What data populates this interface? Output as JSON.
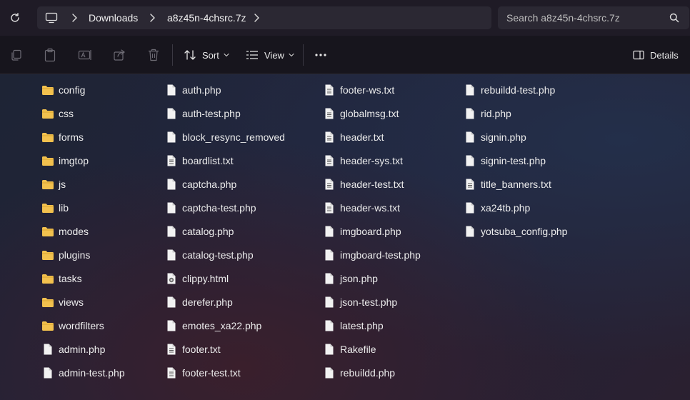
{
  "address_bar": {
    "breadcrumbs": [
      "Downloads",
      "a8z45n-4chsrc.7z"
    ]
  },
  "search": {
    "placeholder": "Search a8z45n-4chsrc.7z"
  },
  "toolbar": {
    "sort_label": "Sort",
    "view_label": "View",
    "details_label": "Details"
  },
  "columns": [
    {
      "items": [
        {
          "name": "config",
          "type": "folder"
        },
        {
          "name": "css",
          "type": "folder"
        },
        {
          "name": "forms",
          "type": "folder"
        },
        {
          "name": "imgtop",
          "type": "folder"
        },
        {
          "name": "js",
          "type": "folder"
        },
        {
          "name": "lib",
          "type": "folder"
        },
        {
          "name": "modes",
          "type": "folder"
        },
        {
          "name": "plugins",
          "type": "folder"
        },
        {
          "name": "tasks",
          "type": "folder"
        },
        {
          "name": "views",
          "type": "folder"
        },
        {
          "name": "wordfilters",
          "type": "folder"
        },
        {
          "name": "admin.php",
          "type": "file"
        },
        {
          "name": "admin-test.php",
          "type": "file"
        }
      ]
    },
    {
      "items": [
        {
          "name": "auth.php",
          "type": "file"
        },
        {
          "name": "auth-test.php",
          "type": "file"
        },
        {
          "name": "block_resync_removed",
          "type": "file"
        },
        {
          "name": "boardlist.txt",
          "type": "text"
        },
        {
          "name": "captcha.php",
          "type": "file"
        },
        {
          "name": "captcha-test.php",
          "type": "file"
        },
        {
          "name": "catalog.php",
          "type": "file"
        },
        {
          "name": "catalog-test.php",
          "type": "file"
        },
        {
          "name": "clippy.html",
          "type": "html"
        },
        {
          "name": "derefer.php",
          "type": "file"
        },
        {
          "name": "emotes_xa22.php",
          "type": "file"
        },
        {
          "name": "footer.txt",
          "type": "text"
        },
        {
          "name": "footer-test.txt",
          "type": "text"
        }
      ]
    },
    {
      "items": [
        {
          "name": "footer-ws.txt",
          "type": "text"
        },
        {
          "name": "globalmsg.txt",
          "type": "text"
        },
        {
          "name": "header.txt",
          "type": "text"
        },
        {
          "name": "header-sys.txt",
          "type": "text"
        },
        {
          "name": "header-test.txt",
          "type": "text"
        },
        {
          "name": "header-ws.txt",
          "type": "text"
        },
        {
          "name": "imgboard.php",
          "type": "file"
        },
        {
          "name": "imgboard-test.php",
          "type": "file"
        },
        {
          "name": "json.php",
          "type": "file"
        },
        {
          "name": "json-test.php",
          "type": "file"
        },
        {
          "name": "latest.php",
          "type": "file"
        },
        {
          "name": "Rakefile",
          "type": "file"
        },
        {
          "name": "rebuildd.php",
          "type": "file"
        }
      ]
    },
    {
      "items": [
        {
          "name": "rebuildd-test.php",
          "type": "file"
        },
        {
          "name": "rid.php",
          "type": "file"
        },
        {
          "name": "signin.php",
          "type": "file"
        },
        {
          "name": "signin-test.php",
          "type": "file"
        },
        {
          "name": "title_banners.txt",
          "type": "text"
        },
        {
          "name": "xa24tb.php",
          "type": "file"
        },
        {
          "name": "yotsuba_config.php",
          "type": "file"
        }
      ]
    }
  ],
  "colors": {
    "folder": "#f2c14e",
    "file": "#f2f2f2",
    "accent": "#4aa3ff"
  }
}
